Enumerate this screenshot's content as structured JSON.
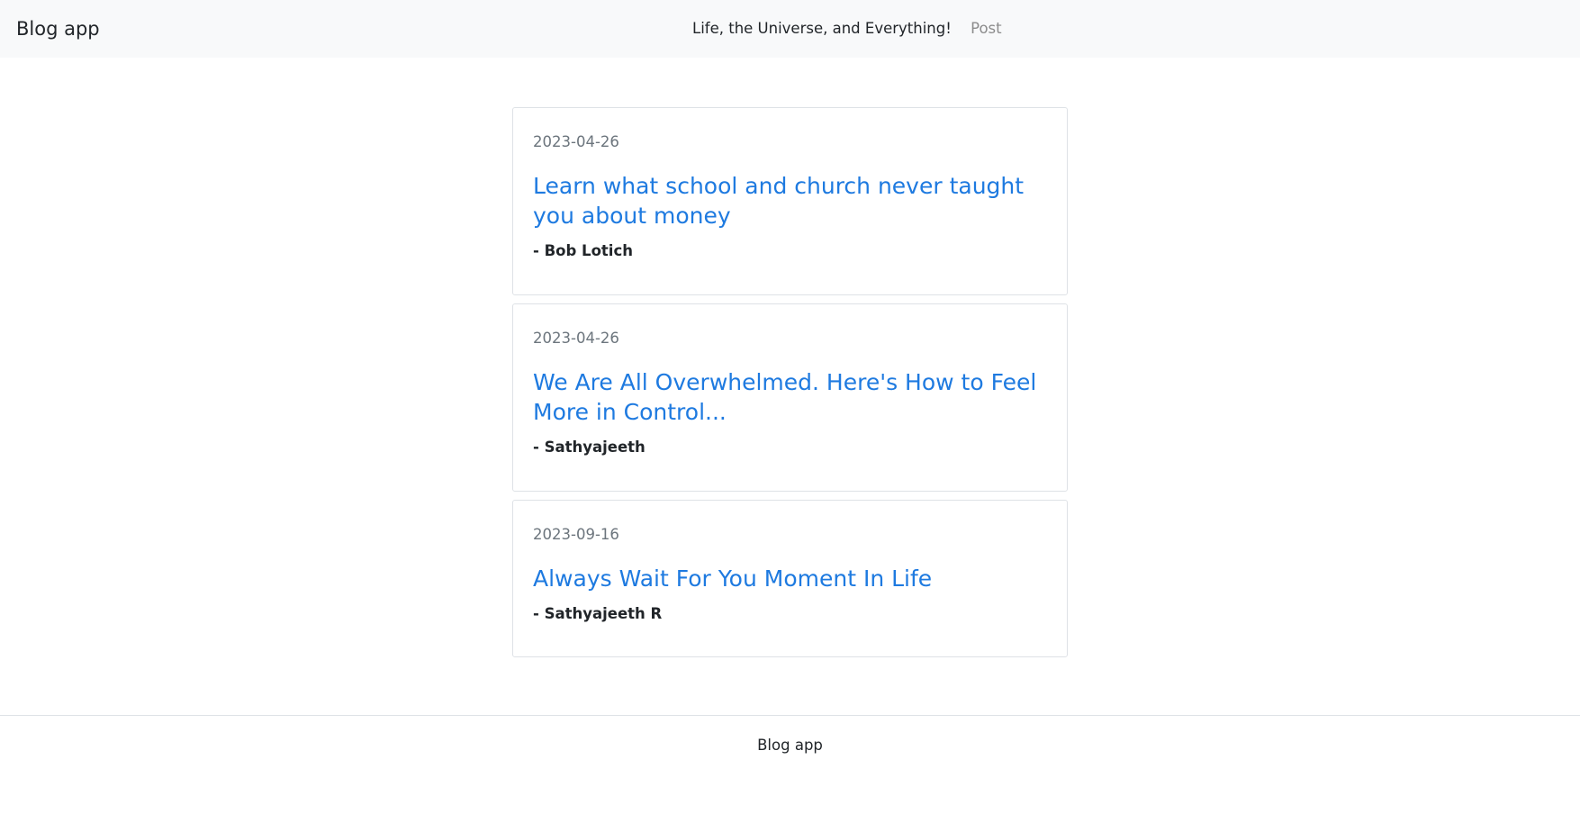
{
  "navbar": {
    "brand": "Blog app",
    "tagline": "Life, the Universe, and Everything!",
    "post_link": "Post"
  },
  "posts": [
    {
      "date": "2023-04-26",
      "title": "Learn what school and church never taught you about money",
      "author": "- Bob Lotich"
    },
    {
      "date": "2023-04-26",
      "title": "We Are All Overwhelmed. Here's How to Feel More in Control...",
      "author": "- Sathyajeeth"
    },
    {
      "date": "2023-09-16",
      "title": "Always Wait For You Moment In Life",
      "author": "- Sathyajeeth R"
    }
  ],
  "footer": {
    "text": "Blog app"
  }
}
